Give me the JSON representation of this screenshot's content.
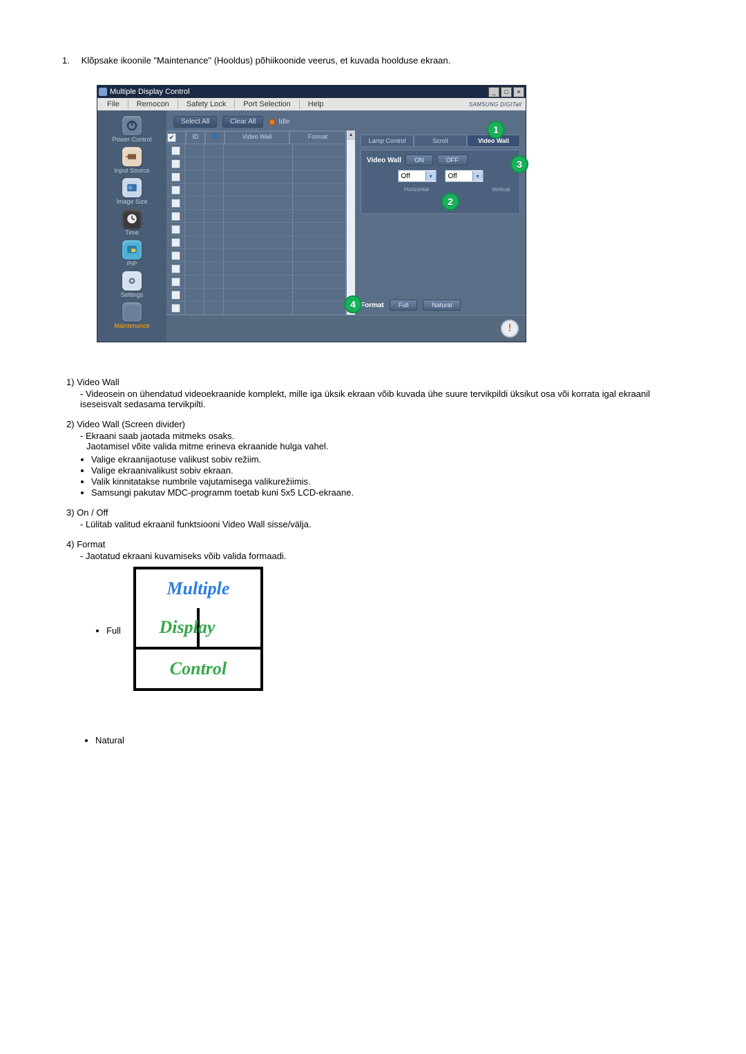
{
  "intro_num": "1.",
  "intro_text": "Klõpsake ikoonile \"Maintenance\" (Hooldus) põhiikoonide veerus, et kuvada hoolduse ekraan.",
  "win": {
    "title": "Multiple Display Control",
    "menu": [
      "File",
      "Remocon",
      "Safety Lock",
      "Port Selection",
      "Help"
    ],
    "brand": "SAMSUNG DIGITall",
    "winbtns": [
      "_",
      "□",
      "×"
    ]
  },
  "toolbar": {
    "select_all": "Select All",
    "clear_all": "Clear All",
    "idle": "Idle"
  },
  "sidebar": {
    "items": [
      {
        "label": "Power Control"
      },
      {
        "label": "Input Source"
      },
      {
        "label": "Image Size"
      },
      {
        "label": "Time"
      },
      {
        "label": "PIP"
      },
      {
        "label": "Settings"
      },
      {
        "label": "Maintenance"
      }
    ]
  },
  "table": {
    "cols": {
      "id": "ID",
      "vw": "Video Wall",
      "fmt": "Format"
    }
  },
  "panel": {
    "tabs": {
      "lamp": "Lamp Control",
      "scroll": "Scroll",
      "video_wall": "Video Wall"
    },
    "video_wall_label": "Video Wall",
    "on": "ON",
    "off": "OFF",
    "dropdown_value": "Off",
    "horizontal": "Horizontal",
    "vertical": "Vertical",
    "format_label": "Format",
    "full": "Full",
    "natural": "Natural"
  },
  "callouts": {
    "c1": "1",
    "c2": "2",
    "c3": "3",
    "c4": "4"
  },
  "desc": {
    "i1": {
      "num": "1)",
      "title": "Video Wall",
      "body": "- Videosein on ühendatud videoekraanide komplekt, mille iga üksik ekraan võib kuvada ühe suure tervikpildi üksikut osa või korrata igal ekraanil iseseisvalt sedasama tervikpilti."
    },
    "i2": {
      "num": "2)",
      "title": "Video Wall (Screen divider)",
      "body1": "- Ekraani saab jaotada mitmeks osaks.",
      "body2": "Jaotamisel võite valida mitme erineva ekraanide hulga vahel.",
      "b1": "Valige ekraanijaotuse valikust sobiv režiim.",
      "b2": "Valige ekraanivalikust sobiv ekraan.",
      "b3": "Valik kinnitatakse numbrile vajutamisega valikurežiimis.",
      "b4": "Samsungi pakutav MDC-programm toetab kuni 5x5 LCD-ekraane."
    },
    "i3": {
      "num": "3)",
      "title": "On / Off",
      "body": "- Lülitab valitud ekraanil funktsiooni Video Wall sisse/välja."
    },
    "i4": {
      "num": "4)",
      "title": "Format",
      "body": "- Jaotatud ekraani kuvamiseks võib valida formaadi.",
      "full_label": "Full",
      "natural_label": "Natural",
      "wt1": "Multiple",
      "wt2": "Display",
      "wt3": "Control"
    }
  }
}
